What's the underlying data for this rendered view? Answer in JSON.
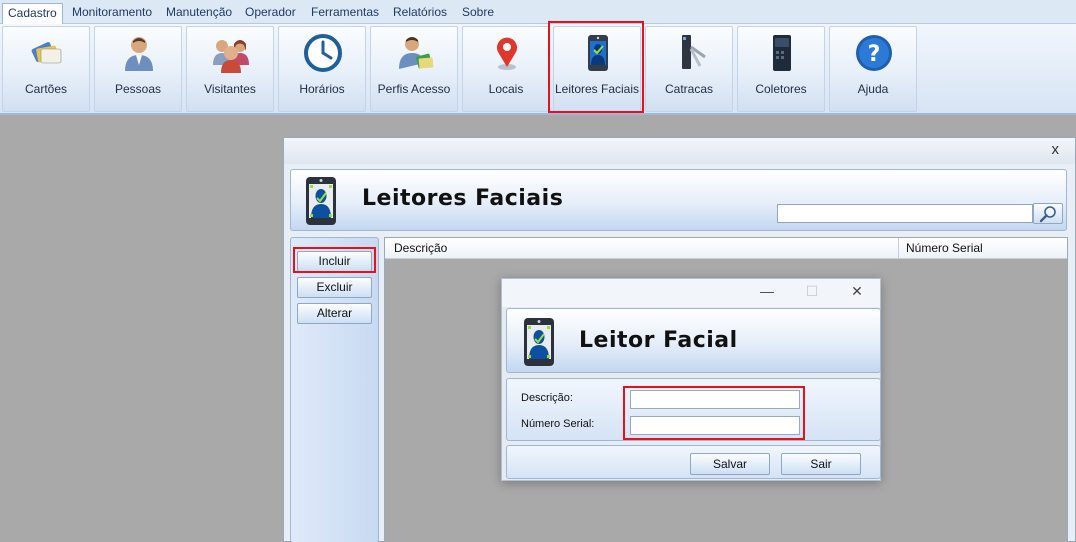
{
  "menu": {
    "items": [
      "Cadastro",
      "Monitoramento",
      "Manutenção",
      "Operador",
      "Ferramentas",
      "Relatórios",
      "Sobre"
    ],
    "active": "Cadastro"
  },
  "ribbon": {
    "buttons": [
      {
        "label": "Cartões",
        "icon": "cards-icon"
      },
      {
        "label": "Pessoas",
        "icon": "person-icon"
      },
      {
        "label": "Visitantes",
        "icon": "visitors-icon"
      },
      {
        "label": "Horários",
        "icon": "clock-icon"
      },
      {
        "label": "Perfis Acesso",
        "icon": "access-profile-icon"
      },
      {
        "label": "Locais",
        "icon": "location-pin-icon"
      },
      {
        "label": "Leitores Faciais",
        "icon": "face-reader-icon"
      },
      {
        "label": "Catracas",
        "icon": "turnstile-icon"
      },
      {
        "label": "Coletores",
        "icon": "collector-icon"
      },
      {
        "label": "Ajuda",
        "icon": "help-icon"
      }
    ],
    "highlighted": "Leitores Faciais"
  },
  "main_window": {
    "close_glyph": "x",
    "title": "Leitores Faciais",
    "search": {
      "value": "",
      "placeholder": ""
    },
    "actions": {
      "include": "Incluir",
      "delete": "Excluir",
      "edit": "Alterar"
    },
    "highlighted_action": "Incluir",
    "table": {
      "columns": [
        "Descrição",
        "Número Serial"
      ],
      "rows": []
    }
  },
  "dialog": {
    "title": "Leitor Facial",
    "minimize_glyph": "—",
    "maximize_glyph": "☐",
    "close_glyph": "✕",
    "fields": {
      "description_label": "Descrição:",
      "description_value": "",
      "serial_label": "Número Serial:",
      "serial_value": ""
    },
    "buttons": {
      "save": "Salvar",
      "exit": "Sair"
    }
  },
  "colors": {
    "highlight": "#e8101a",
    "ribbon_bg": "#d7e4f4",
    "desktop_bg": "#a9a9a9"
  }
}
